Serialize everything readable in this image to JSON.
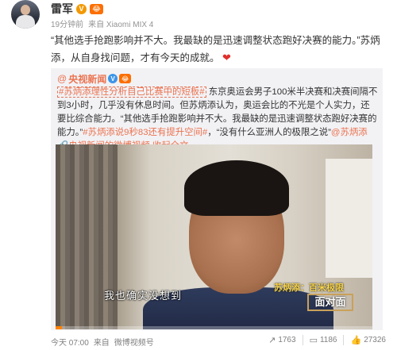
{
  "post": {
    "author": "雷军",
    "vip_badge": "V",
    "crown_badge": "😂",
    "time": "19分钟前",
    "source": "来自 Xiaomi MIX 4",
    "text": "“其他选手抢跑影响并不大。我最缺的是迅速调整状态跑好决赛的能力。”苏炳添，从自身找问题，才有今天的成就。",
    "emoji": "❤"
  },
  "repost": {
    "at": "@",
    "author": "央视新闻",
    "v_badge": "V",
    "crown_badge": "😂",
    "colon": "：",
    "hashtag1": "#苏炳添理性分析自己比赛中的短板#",
    "text1": " 东京奥运会男子100米半决赛和决赛间隔不到3小时，几乎没有休息时间。但苏炳添认为，奥运会比的不光是个人实力，还要比综合能力。“其他选手抢跑影响并不大。我最缺的是迅速调整状态跑好决赛的能力。”",
    "hashtag2": "#苏炳添说9秒83还有提升空间#",
    "text2": "，“没有什么亚洲人的极限之说”",
    "mention": "@苏炳添",
    "video_link": "央视新闻的微博视频",
    "expand": "收起全文",
    "expand_icon": "⌄",
    "icon": "🔗"
  },
  "video": {
    "subtitle": "我也确实没想到",
    "logo_top": "苏炳添：百米极限",
    "logo_box": "面对面",
    "progress": 0.02
  },
  "footer": {
    "time": "今天 07:00",
    "from": "来自",
    "source": "微博视频号",
    "share_count": "1763",
    "comment_count": "1186",
    "like_count": "27326"
  },
  "icons": [
    "share-icon",
    "comment-icon",
    "like-icon",
    "heart-icon"
  ],
  "colors": {
    "link": "#eb7350",
    "accent": "#ff8200"
  }
}
